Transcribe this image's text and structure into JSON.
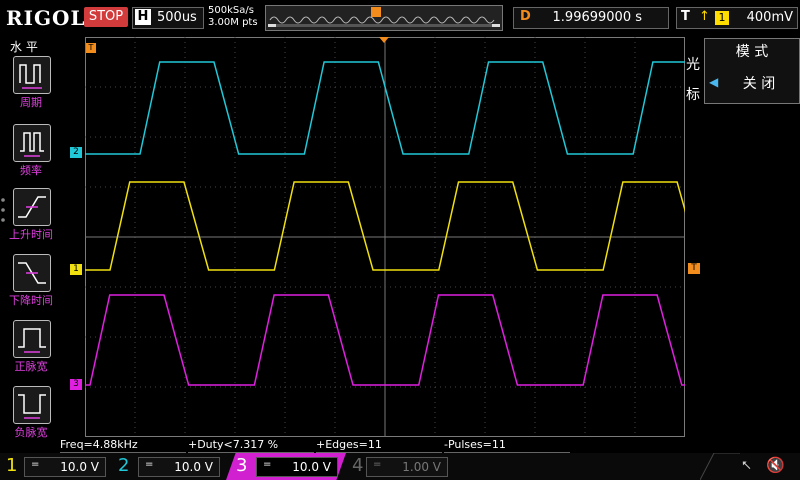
{
  "top": {
    "brand": "RIGOL",
    "run_state": "STOP",
    "timebase_label": "H",
    "timebase_value": "500us",
    "sample_rate": "500kSa/s",
    "memory_depth": "3.00M pts",
    "delay_label": "D",
    "delay_value": "1.99699000 s",
    "trigger_label": "T",
    "trigger_source": "1",
    "trigger_level": "400mV"
  },
  "left_menu": {
    "title": "水 平",
    "items": [
      {
        "label": "周期"
      },
      {
        "label": "频率"
      },
      {
        "label": "上升时间"
      },
      {
        "label": "下降时间"
      },
      {
        "label": "正脉宽"
      },
      {
        "label": "负脉宽"
      }
    ]
  },
  "right_menu": {
    "side_label_1": "光",
    "side_label_2": "标",
    "mode_title": "模 式",
    "mode_value": "关 闭"
  },
  "markers": {
    "ch2": "2",
    "ch1": "1",
    "ch3": "3",
    "trig_left": "T",
    "trig_right": "T"
  },
  "measurements": {
    "freq": "Freq=4.88kHz",
    "duty": "+Duty<7.317 %",
    "edges": "+Edges=11",
    "pulses": "-Pulses=11"
  },
  "channels": [
    {
      "num": "1",
      "coupling": "=",
      "scale": "10.0 V",
      "color": "#f0e010"
    },
    {
      "num": "2",
      "coupling": "=",
      "scale": "10.0 V",
      "color": "#20c8d8"
    },
    {
      "num": "3",
      "coupling": "=",
      "scale": "10.0 V",
      "color": "#e020e0"
    },
    {
      "num": "4",
      "coupling": "=",
      "scale": "1.00 V",
      "color": "#666666"
    }
  ],
  "colors": {
    "ch1": "#f0e010",
    "ch2": "#20c8d8",
    "ch3": "#e020e0",
    "trigger": "#f28c1c",
    "stop": "#d23b3b"
  },
  "icons": [
    "usb-icon",
    "speaker-mute-icon"
  ]
}
